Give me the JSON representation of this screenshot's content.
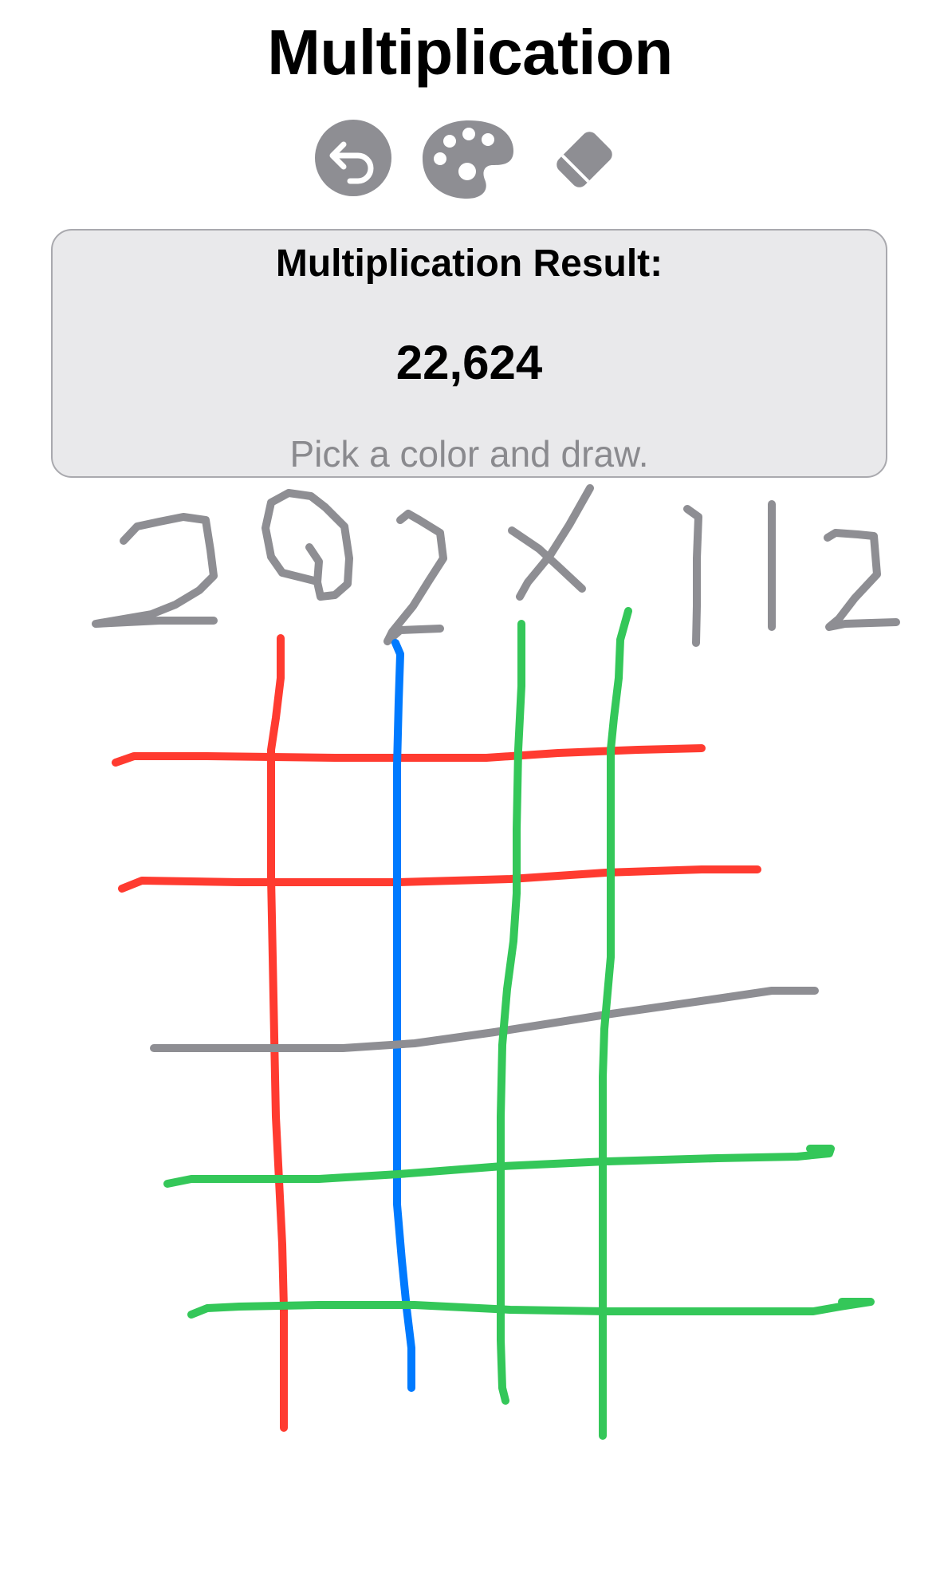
{
  "title": "Multiplication",
  "toolbar": {
    "undo_icon": "undo-arrow-icon",
    "palette_icon": "color-palette-icon",
    "eraser_icon": "eraser-icon",
    "icon_color": "#8e8e93"
  },
  "result": {
    "heading": "Multiplication Result:",
    "value": "22,624",
    "hint": "Pick a color and draw."
  },
  "colors": {
    "card_background": "#e9e9eb",
    "card_border": "#a9a9ae",
    "hint_text": "#8a8a8e",
    "stroke_gray": "#8e8e93",
    "stroke_red": "#ff3b30",
    "stroke_blue": "#007aff",
    "stroke_green": "#34c759"
  }
}
